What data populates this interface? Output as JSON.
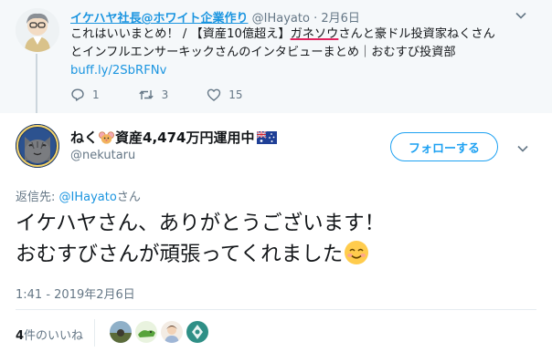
{
  "parent_tweet": {
    "author_name": "イケハヤ社長@ホワイト企業作り",
    "author_handle": "@IHayato",
    "separator": "·",
    "date": "2月6日",
    "text_line1_prefix": "これはいいまとめ！ / 【資産10億超え】",
    "text_line1_highlight": "ガネソウ",
    "text_line1_suffix": "さんと豪ドル投資家ねくさん",
    "text_line2": "とインフルエンサーキックさんのインタビューまとめ｜おむすび投資部",
    "link": "buff.ly/2SbRFNv",
    "reply_count": "1",
    "retweet_count": "3",
    "like_count": "15"
  },
  "main_tweet": {
    "display_name_prefix": "ねく",
    "display_name_suffix": "資産4,474万円運用中",
    "handle": "@nekutaru",
    "follow_label": "フォローする",
    "reply_to_prefix": "返信先: ",
    "reply_to_mention": "@IHayato",
    "reply_to_suffix": "さん",
    "text_line1": "イケハヤさん、ありがとうございます！",
    "text_line2": "おむすびさんが頑張ってくれました",
    "timestamp": "1:41 - 2019年2月6日",
    "likes_count": "4",
    "likes_label": "件のいいね"
  },
  "colors": {
    "link_blue": "#1b95e0",
    "follow_blue": "#1da1f2",
    "muted": "#657786",
    "highlight_underline": "#e0245e"
  },
  "icons": {
    "reply": "reply-icon",
    "retweet": "retweet-icon",
    "like": "heart-icon",
    "chevron": "chevron-down-icon",
    "mouse_emoji": "mouse-face-emoji-icon",
    "flag": "australia-flag-icon",
    "smile": "smiling-face-emoji-icon"
  }
}
